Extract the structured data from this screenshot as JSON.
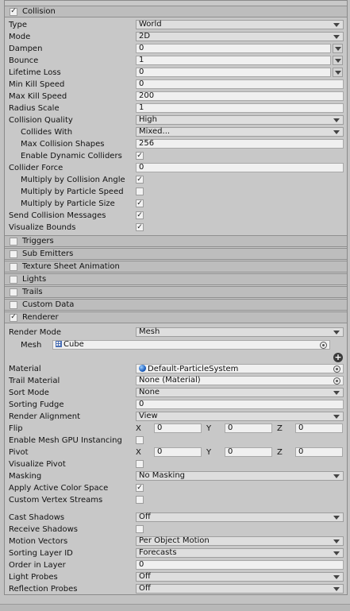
{
  "collision": {
    "header": "Collision",
    "checked": "✓",
    "rows": [
      {
        "label": "Type",
        "value": "World",
        "kind": "drop"
      },
      {
        "label": "Mode",
        "value": "2D",
        "kind": "drop"
      },
      {
        "label": "Dampen",
        "value": "0",
        "kind": "curve"
      },
      {
        "label": "Bounce",
        "value": "1",
        "kind": "curve"
      },
      {
        "label": "Lifetime Loss",
        "value": "0",
        "kind": "curve"
      },
      {
        "label": "Min Kill Speed",
        "value": "0",
        "kind": "field"
      },
      {
        "label": "Max Kill Speed",
        "value": "200",
        "kind": "field"
      },
      {
        "label": "Radius Scale",
        "value": "1",
        "kind": "field"
      },
      {
        "label": "Collision Quality",
        "value": "High",
        "kind": "drop"
      },
      {
        "label": "Collides With",
        "value": "Mixed...",
        "kind": "drop",
        "indent": true
      },
      {
        "label": "Max Collision Shapes",
        "value": "256",
        "kind": "field",
        "indent": true
      },
      {
        "label": "Enable Dynamic Colliders",
        "value": "✓",
        "kind": "check",
        "indent": true
      },
      {
        "label": "Collider Force",
        "value": "0",
        "kind": "field"
      },
      {
        "label": "Multiply by Collision Angle",
        "value": "✓",
        "kind": "check",
        "indent": true
      },
      {
        "label": "Multiply by Particle Speed",
        "value": "",
        "kind": "check",
        "indent": true
      },
      {
        "label": "Multiply by Particle Size",
        "value": "✓",
        "kind": "check",
        "indent": true
      },
      {
        "label": "Send Collision Messages",
        "value": "✓",
        "kind": "check"
      },
      {
        "label": "Visualize Bounds",
        "value": "✓",
        "kind": "check"
      }
    ]
  },
  "modules": [
    {
      "label": "Triggers",
      "checked": ""
    },
    {
      "label": "Sub Emitters",
      "checked": ""
    },
    {
      "label": "Texture Sheet Animation",
      "checked": ""
    },
    {
      "label": "Lights",
      "checked": ""
    },
    {
      "label": "Trails",
      "checked": ""
    },
    {
      "label": "Custom Data",
      "checked": ""
    }
  ],
  "renderer": {
    "header": "Renderer",
    "checked": "✓",
    "render_mode_label": "Render Mode",
    "render_mode_value": "Mesh",
    "mesh_label": "Mesh",
    "mesh_value": "Cube",
    "add_symbol": "+",
    "xyz": {
      "x": "X",
      "y": "Y",
      "z": "Z"
    },
    "rows": [
      {
        "label": "Material",
        "value": "Default-ParticleSystem",
        "kind": "object",
        "icon": "material"
      },
      {
        "label": "Trail Material",
        "value": "None (Material)",
        "kind": "object"
      },
      {
        "label": "Sort Mode",
        "value": "None",
        "kind": "drop"
      },
      {
        "label": "Sorting Fudge",
        "value": "0",
        "kind": "field"
      },
      {
        "label": "Render Alignment",
        "value": "View",
        "kind": "drop"
      },
      {
        "label": "Flip",
        "kind": "xyz",
        "values": [
          "0",
          "0",
          "0"
        ]
      },
      {
        "label": "Enable Mesh GPU Instancing",
        "value": "",
        "kind": "check"
      },
      {
        "label": "Pivot",
        "kind": "xyz",
        "values": [
          "0",
          "0",
          "0"
        ]
      },
      {
        "label": "Visualize Pivot",
        "value": "",
        "kind": "check"
      },
      {
        "label": "Masking",
        "value": "No Masking",
        "kind": "drop"
      },
      {
        "label": "Apply Active Color Space",
        "value": "✓",
        "kind": "check"
      },
      {
        "label": "Custom Vertex Streams",
        "value": "",
        "kind": "check"
      }
    ],
    "rows2": [
      {
        "label": "Cast Shadows",
        "value": "Off",
        "kind": "drop"
      },
      {
        "label": "Receive Shadows",
        "value": "",
        "kind": "check"
      },
      {
        "label": "Motion Vectors",
        "value": "Per Object Motion",
        "kind": "drop"
      },
      {
        "label": "Sorting Layer ID",
        "value": "Forecasts",
        "kind": "drop"
      },
      {
        "label": "Order in Layer",
        "value": "0",
        "kind": "field"
      },
      {
        "label": "Light Probes",
        "value": "Off",
        "kind": "drop"
      },
      {
        "label": "Reflection Probes",
        "value": "Off",
        "kind": "drop"
      }
    ]
  }
}
